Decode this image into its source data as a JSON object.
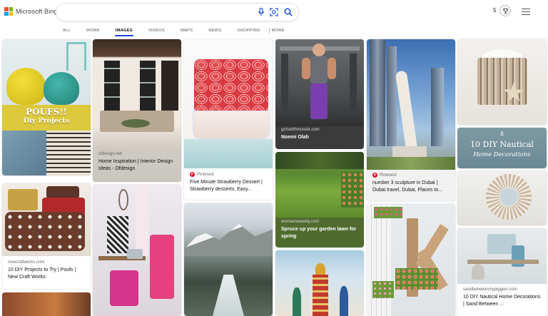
{
  "header": {
    "logo_text": "Microsoft Bing",
    "logo_colors": [
      "#f25022",
      "#7fba00",
      "#00a4ef",
      "#ffb900"
    ],
    "search": {
      "value": "",
      "placeholder": ""
    },
    "rewards_count": "5"
  },
  "tabs": [
    {
      "label": "ALL",
      "active": false
    },
    {
      "label": "WORK",
      "active": false
    },
    {
      "label": "IMAGES",
      "active": true
    },
    {
      "label": "VIDEOS",
      "active": false
    },
    {
      "label": "MAPS",
      "active": false
    },
    {
      "label": "NEWS",
      "active": false
    },
    {
      "label": "SHOPPING",
      "active": false
    }
  ],
  "more_label": "MORE",
  "accent_color": "#174ae4",
  "results": {
    "poufs": {
      "overlay_line1": "POUFS!!",
      "overlay_line2": "Diy Projects"
    },
    "ofdesign": {
      "source": "ofdesign.net",
      "title": "Home Inspiration | Interior Design Ideas - Ofdesign"
    },
    "strawberry": {
      "source": "Pinterest",
      "title": "Five Minute Strawberry Dessert | Strawberry desserts, Easy..."
    },
    "girlswithmuscle": {
      "source": "girlswithmuscle.com",
      "title": "Noemi Olah"
    },
    "dubai": {
      "source": "Pinterest",
      "title": "number 3 sculpture in Dubai | Dubai travel, Dubai, Places to..."
    },
    "nautical_banner": {
      "line1": "10 DIY Nautical",
      "line2": "Home Decorations"
    },
    "newcraftworks": {
      "source": "newcraftworks.com",
      "title": "10 DIY Projects to Try | Poufs | New Craft Works"
    },
    "womansweekly": {
      "source": "womansweekly.com",
      "title": "Spruce up your garden lawn for spring"
    },
    "sandbetween": {
      "source": "sandbetweenmypiggies.com",
      "title": "10 DIY Nautical Home Decorations | Sand Between ..."
    }
  }
}
